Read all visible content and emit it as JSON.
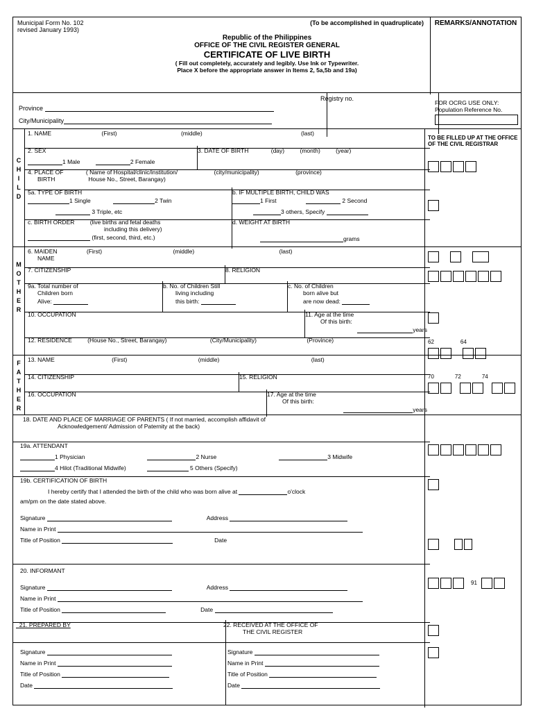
{
  "header": {
    "form_no": "Municipal Form No. 102",
    "revised": "revised January 1993)",
    "quad": "(To be accomplished in quadruplicate)",
    "remarks": "REMARKS/ANNOTATION",
    "republic": "Republic of the Philippines",
    "office": "OFFICE OF THE CIVIL REGISTER GENERAL",
    "title": "CERTIFICATE OF LIVE BIRTH",
    "instr1": "( Fill out completely, accurately and legibly. Use Ink or Typewriter.",
    "instr2": "Place X before the appropriate answer in Items 2, 5a,5b and 19a)"
  },
  "reg": {
    "province": "Province",
    "city": "City/Municipality",
    "registry": "Registry no.",
    "ocrg": "FOR OCRG USE ONLY:",
    "popref": "Population Reference No."
  },
  "rightcol": {
    "fillup": "TO BE FILLED UP AT THE OFFICE OF THE CIVIL REGISTRAR",
    "n62": "62",
    "n64": "64",
    "n70": "70",
    "n72": "72",
    "n74": "74",
    "n91": "91"
  },
  "child": {
    "s1": "1.   NAME",
    "first": "(First)",
    "middle": "(middle)",
    "last": "(last)",
    "s2": "2.   SEX",
    "male": "1  Male",
    "female": "2  Female",
    "s3": "3.   DATE OF BIRTH",
    "day": "(day)",
    "month": "(month)",
    "year": "(year)",
    "s4": "4. PLACE OF",
    "s4b": "BIRTH",
    "s4h": "( Name of Hospital/clinic/institution/",
    "s4h2": "House No., Street, Barangay)",
    "s4c": "(city/municipality)",
    "s4p": "(province)",
    "s5a": "5a. TYPE OF BIRTH",
    "single": "1    Single",
    "twin": "2  Twin",
    "triple": "3 Triple, etc",
    "s5b": "b. IF MULTIPLE BIRTH, CHILD WAS",
    "bfirst": "1  First",
    "bsecond": "2  Second",
    "bothers": "3   others, Specify",
    "s5c": "c. BIRTH ORDER",
    "s5c2": "(live births and fetal deaths",
    "s5c3": "including this delivery)",
    "s5c4": "(first, second, third, etc.)",
    "s5d": "d. WEIGHT AT BIRTH",
    "grams": "grams"
  },
  "mother": {
    "s6": "6. MAIDEN",
    "s6b": "NAME",
    "s7": "7. CITIZENSHIP",
    "s8": "8. RELIGION",
    "s9a": "9a. Total number of",
    "s9a2": "Children born",
    "s9a3": "Alive:",
    "s9b": "b.   No. of Children Still",
    "s9b2": "living including",
    "s9b3": "this birth:",
    "s9c": "c.    No. of Children",
    "s9c2": "born alive but",
    "s9c3": "are now dead:",
    "s10": "10. OCCUPATION",
    "s11": "11.    Age at the time",
    "s11b": "Of this birth:",
    "years": "years",
    "s12": "12.   RESIDENCE",
    "s12a": "(House No., Street, Barangay)",
    "s12b": "(City/Municipality)",
    "s12c": "(Province)"
  },
  "father": {
    "s13": "13. NAME",
    "s14": "14.  CITIZENSHIP",
    "s15": "15.   RELIGION",
    "s16": "16.  OCCUPATION",
    "s17": "17.    Age at the time",
    "s17b": "Of this birth:",
    "years": "years"
  },
  "bottom": {
    "s18": "18.   DATE AND PLACE OF MARRIAGE OF PARENTS    ( If not married, accomplish affidavit of",
    "s18b": "Acknowledgement/ Admission of Paternity at the back)",
    "s19a": "19a.  ATTENDANT",
    "phys": "1 Physician",
    "nurse": "2     Nurse",
    "midwife": "3     Midwife",
    "hilot": "4 Hilot (Traditional Midwife)",
    "others": "5     Others (Specify)",
    "s19b": "19b.  CERTIFICATION OF BIRTH",
    "cert": "I hereby certify that I attended the birth of the child who was born alive at",
    "oclock": "o'clock",
    "cert2": "am/pm on the date stated above.",
    "sig": "Signature",
    "addr": "Address",
    "nip": "Name in Print",
    "top": "Title of Position",
    "date": "Date",
    "s20": "20.    INFORMANT",
    "s21": "21.    PREPARED BY",
    "s22": "22.    RECEIVED   AT   THE   OFFICE   OF",
    "s22b": "THE  CIVIL  REGISTER"
  }
}
